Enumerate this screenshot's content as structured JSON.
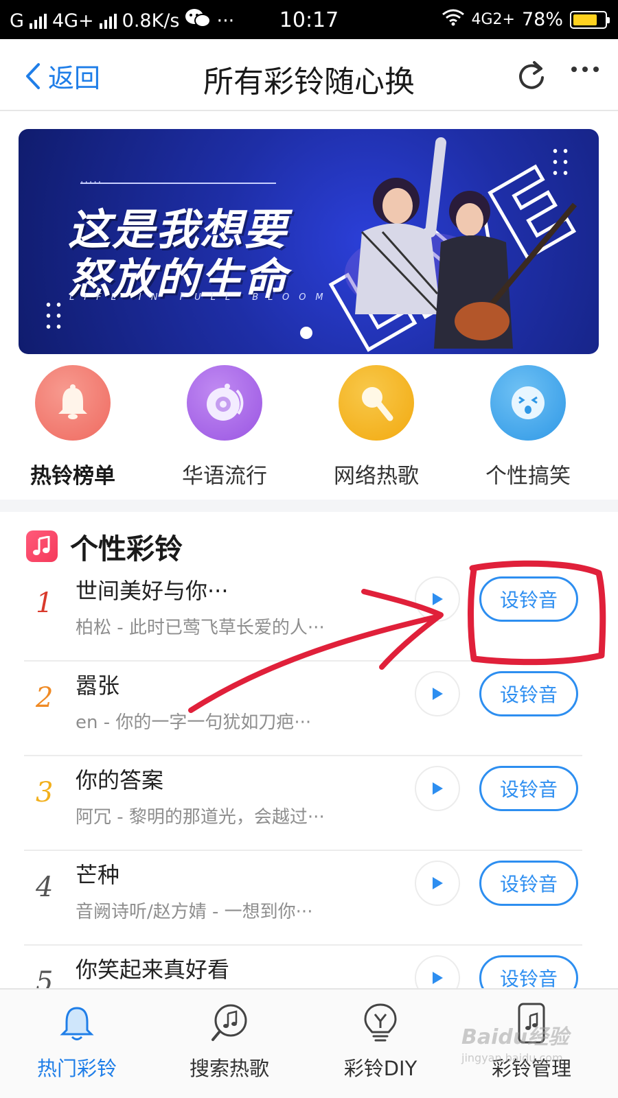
{
  "status_bar": {
    "carrier_left": "G",
    "network_left": "4G+",
    "speed": "0.8K/s",
    "more_dots": "···",
    "time": "10:17",
    "network_right": "4G2+",
    "battery": "78%",
    "battery_level": 0.78,
    "battery_color": "#ffd21f"
  },
  "navbar": {
    "back_label": "返回",
    "title": "所有彩铃随心换",
    "accent": "#1f7ee8"
  },
  "banner": {
    "line1": "这是我想要",
    "line2": "怒放的生命",
    "subtitle": "LIFE IN FULL BLOOM",
    "decor_word": "LIVE",
    "page_indicator": "1"
  },
  "categories": [
    {
      "label": "热铃榜单",
      "icon": "bell-icon",
      "color": "#f36b62"
    },
    {
      "label": "华语流行",
      "icon": "disc-icon",
      "color": "#a45ee8"
    },
    {
      "label": "网络热歌",
      "icon": "microphone-icon",
      "color": "#f3ad1f"
    },
    {
      "label": "个性搞笑",
      "icon": "funny-face-icon",
      "color": "#2e9be8"
    }
  ],
  "section": {
    "title": "个性彩铃",
    "icon": "music-note-icon"
  },
  "songs": [
    {
      "rank": "1",
      "name": "世间美好与你···",
      "desc": "柏松 - 此时已莺飞草长爱的人···",
      "button": "设铃音",
      "rank_color": "#d93a2c"
    },
    {
      "rank": "2",
      "name": "嚣张",
      "desc": "en - 你的一字一句犹如刀疤···",
      "button": "设铃音",
      "rank_color": "#f08a24"
    },
    {
      "rank": "3",
      "name": "你的答案",
      "desc": "阿冗 - 黎明的那道光，会越过···",
      "button": "设铃音",
      "rank_color": "#f2b01d"
    },
    {
      "rank": "4",
      "name": "芒种",
      "desc": "音阙诗听/赵方婧 - 一想到你···",
      "button": "设铃音",
      "rank_color": "#555555"
    },
    {
      "rank": "5",
      "name": "你笑起来真好看",
      "desc": "",
      "button": "设铃音",
      "rank_color": "#555555"
    }
  ],
  "tabs": [
    {
      "label": "热门彩铃",
      "icon": "bell-icon",
      "active": true
    },
    {
      "label": "搜索热歌",
      "icon": "search-music-icon",
      "active": false
    },
    {
      "label": "彩铃DIY",
      "icon": "bulb-icon",
      "active": false
    },
    {
      "label": "彩铃管理",
      "icon": "phone-music-icon",
      "active": false
    }
  ],
  "watermark": {
    "text": "Baidu经验",
    "sub": "jingyan.baidu.com"
  }
}
